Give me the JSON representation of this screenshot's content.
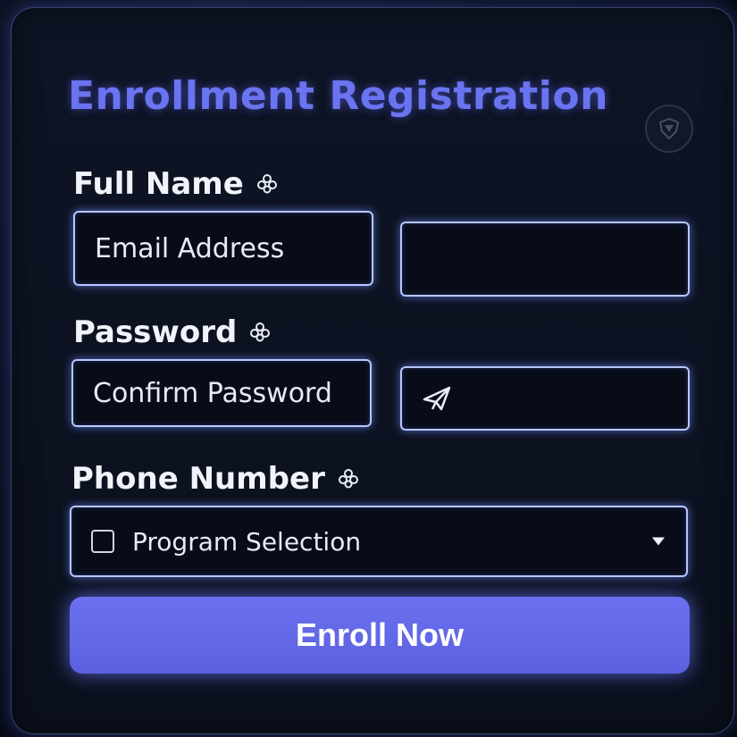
{
  "form": {
    "title": "Enrollment Registration",
    "labels": {
      "full_name": "Full Name",
      "password": "Password",
      "phone_number": "Phone Number"
    },
    "fields": {
      "email_placeholder": "Email Address",
      "second_field_value": "",
      "confirm_password_placeholder": "Confirm Password",
      "message_field_value": "",
      "program_selection": "Program Selection"
    },
    "submit_label": "Enroll Now"
  },
  "icons": {
    "header_badge": "shield-icon",
    "full_name_hint": "flower-icon",
    "password_hint": "flower-icon",
    "phone_hint": "flower-icon",
    "message_field_icon": "send-icon",
    "dropdown": "chevron-down-icon"
  },
  "colors": {
    "accent": "#6a73f0",
    "field_border": "#b8c6ff",
    "button": "#5f65e6"
  }
}
